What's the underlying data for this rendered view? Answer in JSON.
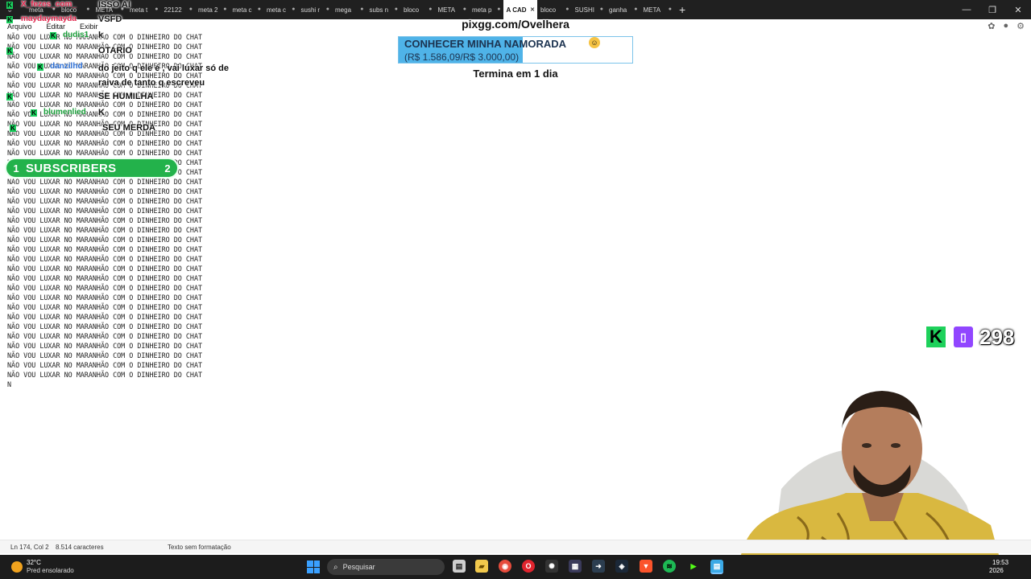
{
  "browser": {
    "tabs": [
      {
        "label": "meta",
        "active": false
      },
      {
        "label": "bloco",
        "active": false
      },
      {
        "label": "META",
        "active": false
      },
      {
        "label": "meta t",
        "active": false
      },
      {
        "label": "22122",
        "active": false
      },
      {
        "label": "meta 2",
        "active": false
      },
      {
        "label": "meta c",
        "active": false
      },
      {
        "label": "meta c",
        "active": false
      },
      {
        "label": "sushi r",
        "active": false
      },
      {
        "label": "mega",
        "active": false
      },
      {
        "label": "subs n",
        "active": false
      },
      {
        "label": "bloco",
        "active": false
      },
      {
        "label": "META",
        "active": false
      },
      {
        "label": "meta p",
        "active": false
      },
      {
        "label": "A CAD",
        "active": true
      },
      {
        "label": "bloco",
        "active": false
      },
      {
        "label": "SUSHI",
        "active": false
      },
      {
        "label": "ganha",
        "active": false
      },
      {
        "label": "META",
        "active": false
      }
    ],
    "new_tab": "+",
    "window_controls": {
      "minimize": "—",
      "maximize": "❐",
      "close": "✕"
    }
  },
  "notepad": {
    "menu": [
      "Arquivo",
      "Editar",
      "Exibir"
    ],
    "line_text": "NÃO VOU LUXAR NO MARANHÃO COM O DINHEIRO DO CHAT",
    "line_count": 36,
    "caret_text": "N",
    "status": {
      "position": "Ln 174, Col 2",
      "characters": "8.514 caracteres",
      "format": "Texto sem formatação"
    }
  },
  "chat": [
    {
      "name": "X_fezes_com_",
      "message": "ISSO AI",
      "name_color": "#e0234a"
    },
    {
      "name": "maydaymayda",
      "message": "VSFD",
      "name_color": "#e0234a"
    },
    {
      "name": "dudis1",
      "message": "k",
      "name_color": "#1a9e3a"
    },
    {
      "name": "",
      "message": "OTARIO",
      "name_color": "#e0234a"
    },
    {
      "name": "danzilhd",
      "message": "do jeito q ele é , vai luxar só de raiva de tanto q escreveu",
      "name_color": "#2b6fd6"
    },
    {
      "name": "",
      "message": "SE HUMILHA",
      "name_color": "#e0234a"
    },
    {
      "name": "blumenlied",
      "message": "K",
      "name_color": "#1a9e3a"
    },
    {
      "name": "",
      "message": "SEU MERDA",
      "name_color": "#e0234a"
    }
  ],
  "subscribers": {
    "current": "1",
    "label": "SUBSCRIBERS",
    "goal": "2"
  },
  "pix_goal": {
    "title": "pixgg.com/Ovelhera",
    "goal_label": "CONHECER MINHA NAMORADA",
    "amount": "(R$ 1.586,09/R$ 3.000,00)",
    "progress_fraction": 0.53,
    "ends": "Termina em 1 dia",
    "accent": "#4fb3e8"
  },
  "viewers": {
    "count": "298",
    "kick_color": "#1ed15b",
    "twitch_color": "#9146ff"
  },
  "taskbar": {
    "weather_temp": "32°C",
    "weather_desc": "Pred ensolarado",
    "search_placeholder": "Pesquisar",
    "apps": [
      "file-manager-icon",
      "folder-icon",
      "chrome-icon",
      "opera-icon",
      "chatgpt-icon",
      "app-icon",
      "arrow-icon",
      "steam-icon",
      "brave-icon",
      "spotify-icon",
      "kick-icon",
      "notepad-icon"
    ],
    "time": "19:53",
    "date": "2026"
  }
}
